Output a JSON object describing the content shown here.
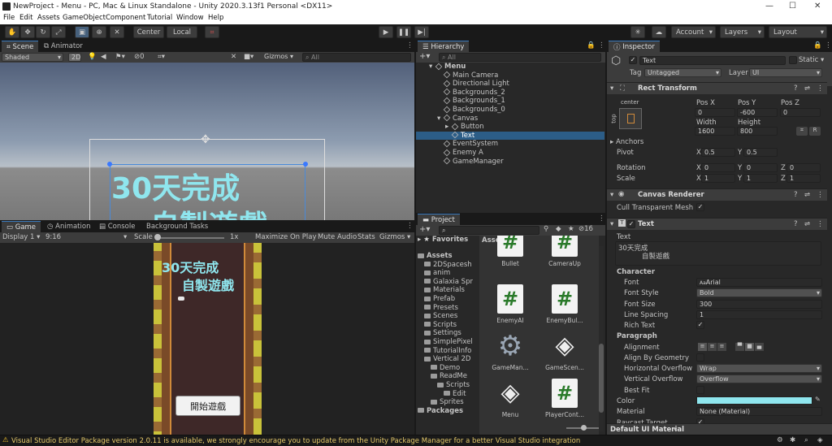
{
  "window": {
    "title": "NewProject - Menu - PC, Mac & Linux Standalone - Unity 2020.3.13f1 Personal <DX11>",
    "minimize": "—",
    "maximize": "☐",
    "close": "✕"
  },
  "menu": [
    "File",
    "Edit",
    "Assets",
    "GameObject",
    "Component",
    "Tutorial",
    "Window",
    "Help"
  ],
  "toolbar": {
    "pivot_center": "Center",
    "pivot_local": "Local",
    "account": "Account",
    "layers": "Layers",
    "layout": "Layout"
  },
  "scene": {
    "tab_scene": "Scene",
    "tab_animator": "Animator",
    "shading": "Shaded",
    "mode_2d": "2D",
    "hidden_count": "0",
    "gizmos": "Gizmos",
    "search_placeholder": "All",
    "text_line1": "30天完成",
    "text_line2": "自製遊戲"
  },
  "game": {
    "tab_game": "Game",
    "tab_animation": "Animation",
    "tab_console": "Console",
    "tab_background": "Background Tasks",
    "display": "Display 1",
    "aspect": "9:16",
    "scale_label": "Scale",
    "scale_value": "1x",
    "maximize": "Maximize On Play",
    "mute": "Mute Audio",
    "stats": "Stats",
    "gizmos": "Gizmos",
    "title_line1": "30天完成",
    "title_line2": "自製遊戲",
    "start_button": "開始遊戲"
  },
  "hierarchy": {
    "tab": "Hierarchy",
    "search_placeholder": "All",
    "items": [
      {
        "label": "Menu",
        "indent": 1,
        "type": "scene"
      },
      {
        "label": "Main Camera",
        "indent": 2,
        "type": "go"
      },
      {
        "label": "Directional Light",
        "indent": 2,
        "type": "go"
      },
      {
        "label": "Backgrounds_2",
        "indent": 2,
        "type": "go"
      },
      {
        "label": "Backgrounds_1",
        "indent": 2,
        "type": "go"
      },
      {
        "label": "Backgrounds_0",
        "indent": 2,
        "type": "go"
      },
      {
        "label": "Canvas",
        "indent": 2,
        "type": "go"
      },
      {
        "label": "Button",
        "indent": 3,
        "type": "go"
      },
      {
        "label": "Text",
        "indent": 3,
        "type": "go",
        "selected": true
      },
      {
        "label": "EventSystem",
        "indent": 2,
        "type": "go"
      },
      {
        "label": "Enemy A",
        "indent": 2,
        "type": "go"
      },
      {
        "label": "GameManager",
        "indent": 2,
        "type": "go"
      }
    ]
  },
  "project": {
    "tab": "Project",
    "hidden_count": "16",
    "favorites": "Favorites",
    "assets_root": "Assets",
    "breadcrumb": "Assets",
    "tree": [
      {
        "label": "Assets",
        "indent": 0,
        "bold": true
      },
      {
        "label": "2DSpacesh",
        "indent": 1
      },
      {
        "label": "anim",
        "indent": 1
      },
      {
        "label": "Galaxia Spr",
        "indent": 1
      },
      {
        "label": "Materials",
        "indent": 1
      },
      {
        "label": "Prefab",
        "indent": 1
      },
      {
        "label": "Presets",
        "indent": 1
      },
      {
        "label": "Scenes",
        "indent": 1
      },
      {
        "label": "Scripts",
        "indent": 1
      },
      {
        "label": "Settings",
        "indent": 1
      },
      {
        "label": "SimplePixel",
        "indent": 1
      },
      {
        "label": "TutorialInfo",
        "indent": 1
      },
      {
        "label": "Vertical 2D",
        "indent": 1
      },
      {
        "label": "Demo",
        "indent": 2
      },
      {
        "label": "ReadMe",
        "indent": 2
      },
      {
        "label": "Scripts",
        "indent": 3
      },
      {
        "label": "Edit",
        "indent": 4
      },
      {
        "label": "Sprites",
        "indent": 2
      },
      {
        "label": "Packages",
        "indent": 0,
        "bold": true
      }
    ],
    "assets": [
      {
        "label": "Bullet",
        "kind": "partial"
      },
      {
        "label": "CameraUp",
        "kind": "partial"
      },
      {
        "label": "EnemyAI",
        "kind": "script"
      },
      {
        "label": "EnemyBul...",
        "kind": "script"
      },
      {
        "label": "GameMan...",
        "kind": "gear"
      },
      {
        "label": "GameScen...",
        "kind": "unity"
      },
      {
        "label": "Menu",
        "kind": "unity"
      },
      {
        "label": "PlayerCont...",
        "kind": "script"
      }
    ]
  },
  "inspector": {
    "tab": "Inspector",
    "object_name": "Text",
    "static": "Static",
    "tag_label": "Tag",
    "tag_value": "Untagged",
    "layer_label": "Layer",
    "layer_value": "UI",
    "rect_transform": {
      "title": "Rect Transform",
      "anchor_label": "center",
      "side_label": "top",
      "pos_x_label": "Pos X",
      "pos_y_label": "Pos Y",
      "pos_z_label": "Pos Z",
      "pos_x": "0",
      "pos_y": "-600",
      "pos_z": "0",
      "width_label": "Width",
      "height_label": "Height",
      "width": "1600",
      "height": "800",
      "r_button": "R",
      "anchors": "Anchors",
      "pivot": "Pivot",
      "pivot_x": "0.5",
      "pivot_y": "0.5",
      "rotation": "Rotation",
      "rot_x": "0",
      "rot_y": "0",
      "rot_z": "0",
      "scale": "Scale",
      "scale_x": "1",
      "scale_y": "1",
      "scale_z": "1",
      "x": "X",
      "y": "Y",
      "z": "Z"
    },
    "canvas_renderer": {
      "title": "Canvas Renderer",
      "cull_label": "Cull Transparent Mesh"
    },
    "text_component": {
      "title": "Text",
      "text_label": "Text",
      "text_line1": "30天完成",
      "text_line2": "自製遊戲",
      "character": "Character",
      "font_label": "Font",
      "font_value": "Arial",
      "font_prefix": "Aa",
      "font_style_label": "Font Style",
      "font_style_value": "Bold",
      "font_size_label": "Font Size",
      "font_size_value": "300",
      "line_spacing_label": "Line Spacing",
      "line_spacing_value": "1",
      "rich_text_label": "Rich Text",
      "paragraph": "Paragraph",
      "alignment_label": "Alignment",
      "align_geometry_label": "Align By Geometry",
      "h_overflow_label": "Horizontal Overflow",
      "h_overflow_value": "Wrap",
      "v_overflow_label": "Vertical Overflow",
      "v_overflow_value": "Overflow",
      "best_fit_label": "Best Fit",
      "color_label": "Color",
      "color_value": "#8fe6ee",
      "material_label": "Material",
      "material_value": "None (Material)",
      "raycast_label": "Raycast Target"
    },
    "default_material": "Default UI Material"
  },
  "status": {
    "message": "Visual Studio Editor Package version 2.0.11 is available, we strongly encourage you to update from the Unity Package Manager for a better Visual Studio integration"
  },
  "colors": {
    "accent": "#3a79bb",
    "selection": "#2c5d87",
    "panel": "#282828",
    "text_cyan": "#8fe6ee"
  }
}
